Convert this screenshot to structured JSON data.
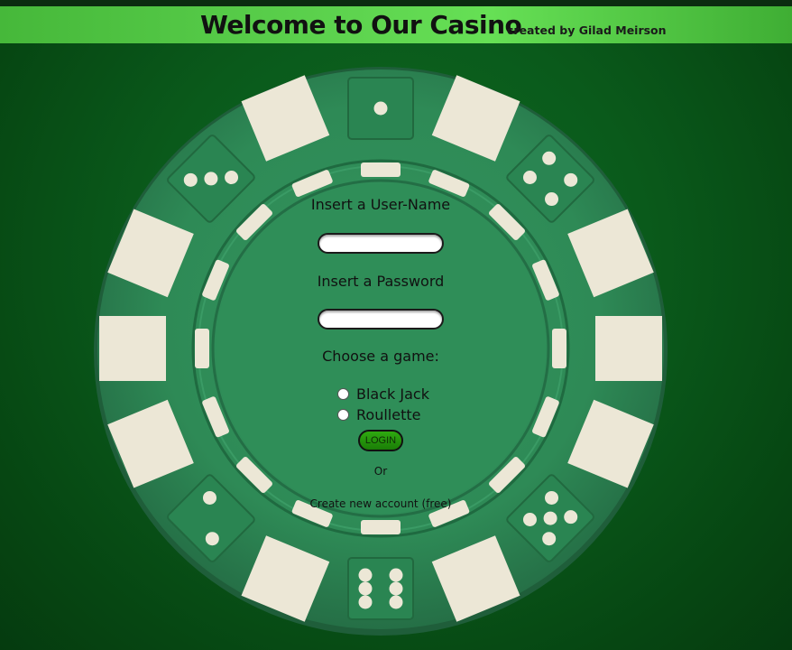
{
  "header": {
    "title": "Welcome to Our Casino",
    "credit": "created by Gilad Meirson"
  },
  "form": {
    "username_label": "Insert a User-Name",
    "username_value": "",
    "password_label": "Insert a Password",
    "password_value": "",
    "game_label": "Choose a game:",
    "games": [
      {
        "label": "Black Jack",
        "selected": false
      },
      {
        "label": "Roullette",
        "selected": false
      }
    ],
    "login_label": "LOGIN",
    "or_text": "Or",
    "create_link": "Create new account (free)"
  },
  "colors": {
    "background": "#0a5a1b",
    "header": "#5ed44f",
    "chip": "#2e8b57",
    "chip_stripe": "#ece7d6",
    "login_button": "#2faa10"
  },
  "icons": [
    "poker-chip",
    "dice-face-1",
    "dice-face-2",
    "dice-face-3",
    "dice-face-4",
    "dice-face-5",
    "dice-face-6"
  ]
}
